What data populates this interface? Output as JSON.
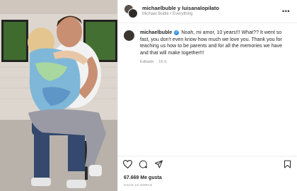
{
  "post": {
    "header": {
      "names": "michaelbuble y luisanalopilato",
      "subtitle": "Michael Bublé • Everything"
    },
    "caption": {
      "username": "michaelbuble",
      "text": "Noah, mi amor, 10 years!!! What?? It went so fast, you don't even know how much we love you. Thank you for teaching us how to be parents and for all the memories we have and that will make together!!!",
      "edited_label": "Editado",
      "edited_time": "16 h"
    },
    "likes": {
      "count": "67.669",
      "label": "Me gusta"
    },
    "timestamp": "HACE 16 HORAS",
    "icons": {
      "more": "more-icon",
      "like": "heart-icon",
      "comment": "comment-icon",
      "share": "share-icon",
      "save": "bookmark-icon",
      "verified": "verified-icon"
    }
  }
}
